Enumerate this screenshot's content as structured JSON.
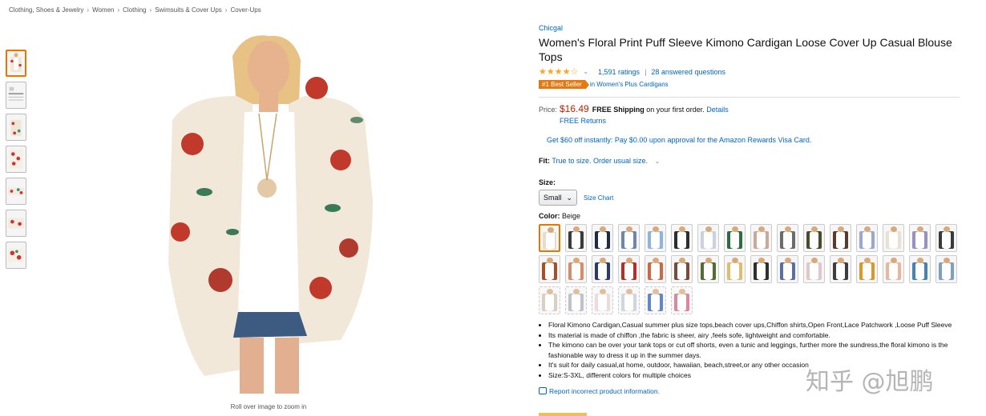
{
  "breadcrumb": [
    "Clothing, Shoes & Jewelry",
    "Women",
    "Clothing",
    "Swimsuits & Cover Ups",
    "Cover-Ups"
  ],
  "breadcrumb_sep": "›",
  "gallery": {
    "zoom_hint": "Roll over image to zoom in",
    "thumb_count": 7
  },
  "product": {
    "brand": "Chicgal",
    "title": "Women's Floral Print Puff Sleeve Kimono Cardigan Loose Cover Up Casual Blouse Tops",
    "stars_glyph": "★★★★☆",
    "rating_value": 4.5,
    "ratings": "1,591 ratings",
    "answered": "28 answered questions",
    "best_seller_badge": "#1 Best Seller",
    "best_seller_category": "in Women's Plus Cardigans",
    "price_label": "Price:",
    "price": "$16.49",
    "free_shipping": "FREE Shipping",
    "shipping_rest": "on your first order.",
    "details": "Details",
    "free_returns": "FREE Returns",
    "promo": "Get $60 off instantly: Pay $0.00 upon approval for the Amazon Rewards Visa Card.",
    "fit_label": "Fit:",
    "fit_text": "True to size. Order usual size.",
    "size_label": "Size:",
    "size_selected": "Small",
    "size_chart": "Size Chart",
    "color_label": "Color:",
    "color_selected": "Beige",
    "bullets": [
      "Floral Kimono Cardigan,Casual summer plus size tops,beach cover ups,Chiffon shirts,Open Front,Lace Patchwork ,Loose Puff Sleeve",
      "Its material is made of chiffon ,the fabric is sheer, airy ,feels sofe, lightweight and comfortable.",
      "The kimono can be over your tank tops or cut off shorts, even a tunic and leggings, further more the sundress,the floral kimono is the fashionable way to dress it up in the summer days.",
      "It's suit for daily casual,at home, outdoor, hawaiian, beach,street,or any other occasion",
      "Size:S-3XL, different colors for multiple choices"
    ],
    "report": "Report incorrect product information."
  },
  "watermark": "知乎 @旭鹏",
  "swatch_colors": [
    "#e9dccb",
    "#3b3b3b",
    "#1f2a44",
    "#6f86a8",
    "#8fb4d9",
    "#2d2d2d",
    "#c9d3e0",
    "#2e6b45",
    "#c8a99a",
    "#6b6b6b",
    "#4b4a2a",
    "#5a3a2a",
    "#9aa9c9",
    "#e6e2d6",
    "#9a8fc2",
    "#3a3a3a",
    "#a0522d",
    "#d98a6a",
    "#2b3a66",
    "#b0302a",
    "#c76a4a",
    "#7a4a3a",
    "#556b2f",
    "#d8c070",
    "#2f2f2f",
    "#5b6fa0",
    "#e0c8c8",
    "#3d3d3d",
    "#d69a2a",
    "#e2b8a0",
    "#4682b4",
    "#7f9fbf",
    "#d0c0b0",
    "#a8b0b8",
    "#e8d0d0",
    "#c0c8d8",
    "#3060b0",
    "#d06080"
  ]
}
